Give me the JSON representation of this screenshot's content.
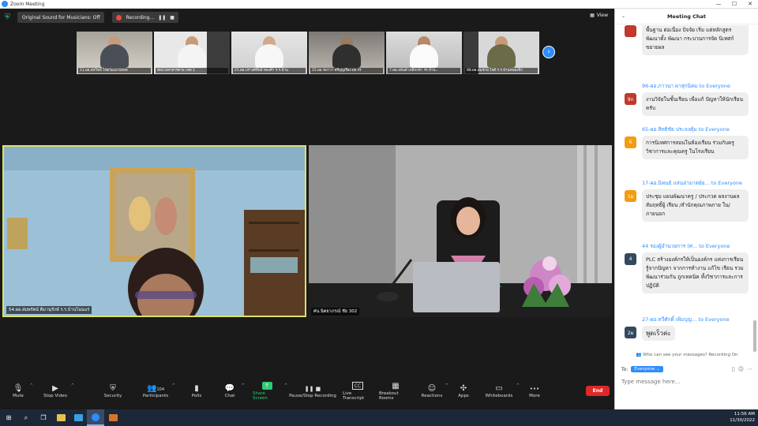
{
  "window": {
    "title": "Zoom Meeting",
    "minimize": "—",
    "maximize": "☐",
    "close": "✕"
  },
  "topbar": {
    "sound_label": "Original Sound for Musicians: Off",
    "recording_label": "Recording...",
    "pause_glyph": "❚❚",
    "stop_glyph": "■",
    "view_label": "View"
  },
  "thumbnails": [
    {
      "name": "11.ผอ.สหวิทย์ ไชยวัฒนาปสลด"
    },
    {
      "name": "สพป.มหาสารคาม เขต 1"
    },
    {
      "name": "21.ผอ.ปรางค์ทิพย์ ทองคำ ร.ร.บ้าน"
    },
    {
      "name": "25.ผอ.ชลาวา ศรีบุญเรือง ผอ.รร"
    },
    {
      "name": "7.ผอ.อนันต์ เหล็กกล้า รร.บ้าน..."
    },
    {
      "name": "88.ผอ.สมชาย ใจดี ร.ร.บ้านหนองจิก"
    }
  ],
  "videos": {
    "left_name": "54.ผอ.สมพรัตน์ คิมานุรักษ์ ร.ร.บ้านโนนแร่",
    "right_name": "ศน.นิตยาภรณ์ ชัย 302"
  },
  "toolbar": [
    {
      "label": "Mute",
      "icon": "🎙"
    },
    {
      "label": "Stop Video",
      "icon": "▶"
    },
    {
      "label": "Security",
      "icon": "⛨"
    },
    {
      "label": "Participants",
      "icon": "👥",
      "count": "104"
    },
    {
      "label": "Polls",
      "icon": "▮"
    },
    {
      "label": "Chat",
      "icon": "💬"
    },
    {
      "label": "Share Screen",
      "icon": "↑"
    },
    {
      "label": "Pause/Stop Recording",
      "icon": "❚❚ ■"
    },
    {
      "label": "Live Transcript",
      "icon": "CC"
    },
    {
      "label": "Breakout Rooms",
      "icon": "▦"
    },
    {
      "label": "Reactions",
      "icon": "☺"
    },
    {
      "label": "Apps",
      "icon": "✣"
    },
    {
      "label": "Whiteboards",
      "icon": "▭"
    },
    {
      "label": "More",
      "icon": "•••"
    }
  ],
  "end_label": "End",
  "chat": {
    "title": "Meeting Chat",
    "messages": [
      {
        "from": "",
        "to": "",
        "avatar": "",
        "color": "#c0392b",
        "text": "พื้นฐาน ต่อเนื่อง ปัจจัย เริ่ม แต่หลักสูตร พัฒนาตั้ง พัฒนา กระบวนการจัด นิเทศก์ ขยายผล"
      },
      {
        "from": "96-ผอ.ภาวนา ผาสุกนิคม",
        "to": "to Everyone",
        "avatar": "9ก",
        "color": "#c0392b",
        "text": "งานวิจัยในชั้นเรียน เพื่อแก้ ปัญหาให้นักเรียนครับ"
      },
      {
        "from": "65-ผอ.สิทธิชัย ประจงคุ้ม",
        "to": "to Everyone",
        "avatar": "6",
        "color": "#f39c12",
        "text": "การนิเทศการสอนในห้องเรียน ร่วมกับครูวิชาการและคุณครู ในโรงเรียน"
      },
      {
        "from": "17-ผอ.นิพนธ์ แสนอ่ามาตย์ย...",
        "to": "to Everyone",
        "avatar": "1ผ",
        "color": "#f39c12",
        "text": "ประชุม แผนพัฒนาครู / ประกวด ผลงานผลสัมฤทธิ์ผู้ เรียน /สำนักคุณภาพภาย ใน/ภายนอก"
      },
      {
        "from": "44 รองผู้อำนวยการ (ศ...",
        "to": "to Everyone",
        "avatar": "4",
        "color": "#34495e",
        "text": "PLC สร้างองค์กรให้เป็นองค์กร แห่งการเรียนรู้จากปัญหา จากการทำงาน แก้ไข เรียน รวม พัฒนาร่วมกัน ถูกเทคนิค ทั้งวิชาการและการปฏิบัติ"
      },
      {
        "from": "27-ผอ.ทวีศักดิ์ เพิ่มบุญ...",
        "to": "to Everyone",
        "avatar": "2ผ",
        "color": "#34495e",
        "text": "พูดเร็วค่ะ"
      }
    ],
    "privacy_note": "Who can see your messages? Recording On",
    "to_label": "To:",
    "recipient": "Everyone",
    "input_placeholder": "Type message here..."
  },
  "taskbar": {
    "time": "11:56 AM",
    "date": "11/30/2022"
  }
}
